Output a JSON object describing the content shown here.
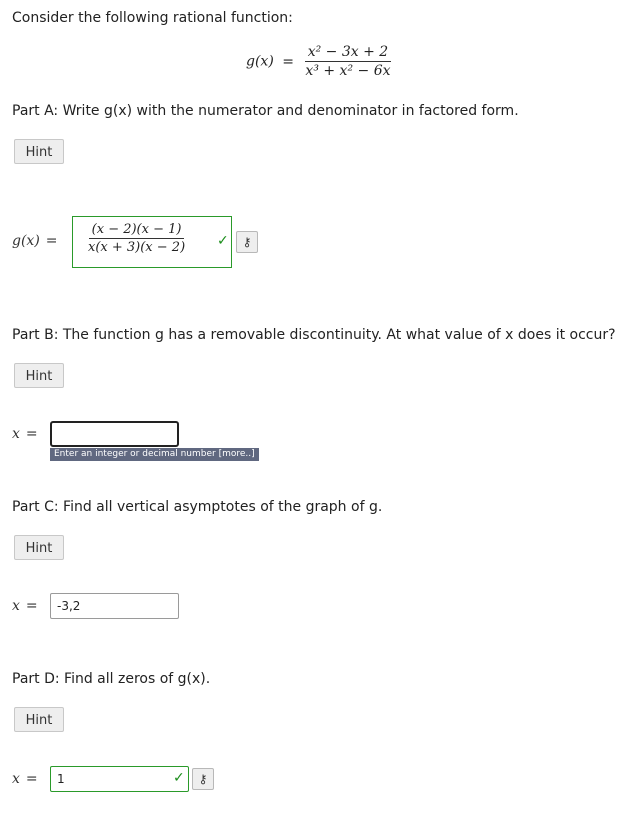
{
  "intro": "Consider the following rational function:",
  "main_function": {
    "lhs": "g(x)",
    "eq": "=",
    "numerator": "x² − 3x + 2",
    "denominator": "x³ + x² − 6x"
  },
  "parts": {
    "a": {
      "prompt": "Part A: Write g(x) with the numerator and denominator in factored form.",
      "hint_label": "Hint",
      "lhs": "g(x)",
      "eq": "=",
      "answer_numerator": "(x − 2)(x − 1)",
      "answer_denominator": "x(x + 3)(x − 2)",
      "status": "correct"
    },
    "b": {
      "prompt": "Part B: The function g has a removable discontinuity. At what value of x does it occur?",
      "hint_label": "Hint",
      "var": "x",
      "eq": "=",
      "value": "",
      "tooltip": "Enter an integer or decimal number [more..]"
    },
    "c": {
      "prompt": "Part C: Find all vertical asymptotes of the graph of g.",
      "hint_label": "Hint",
      "var": "x",
      "eq": "=",
      "value": "-3,2"
    },
    "d": {
      "prompt": "Part D: Find all zeros of g(x).",
      "hint_label": "Hint",
      "var": "x",
      "eq": "=",
      "value": "1",
      "status": "correct"
    }
  },
  "icons": {
    "check": "check-icon",
    "key": "key-icon"
  },
  "colors": {
    "correct": "#1a8d1a",
    "tooltip_bg": "#606880",
    "button_bg": "#eeeeee"
  }
}
